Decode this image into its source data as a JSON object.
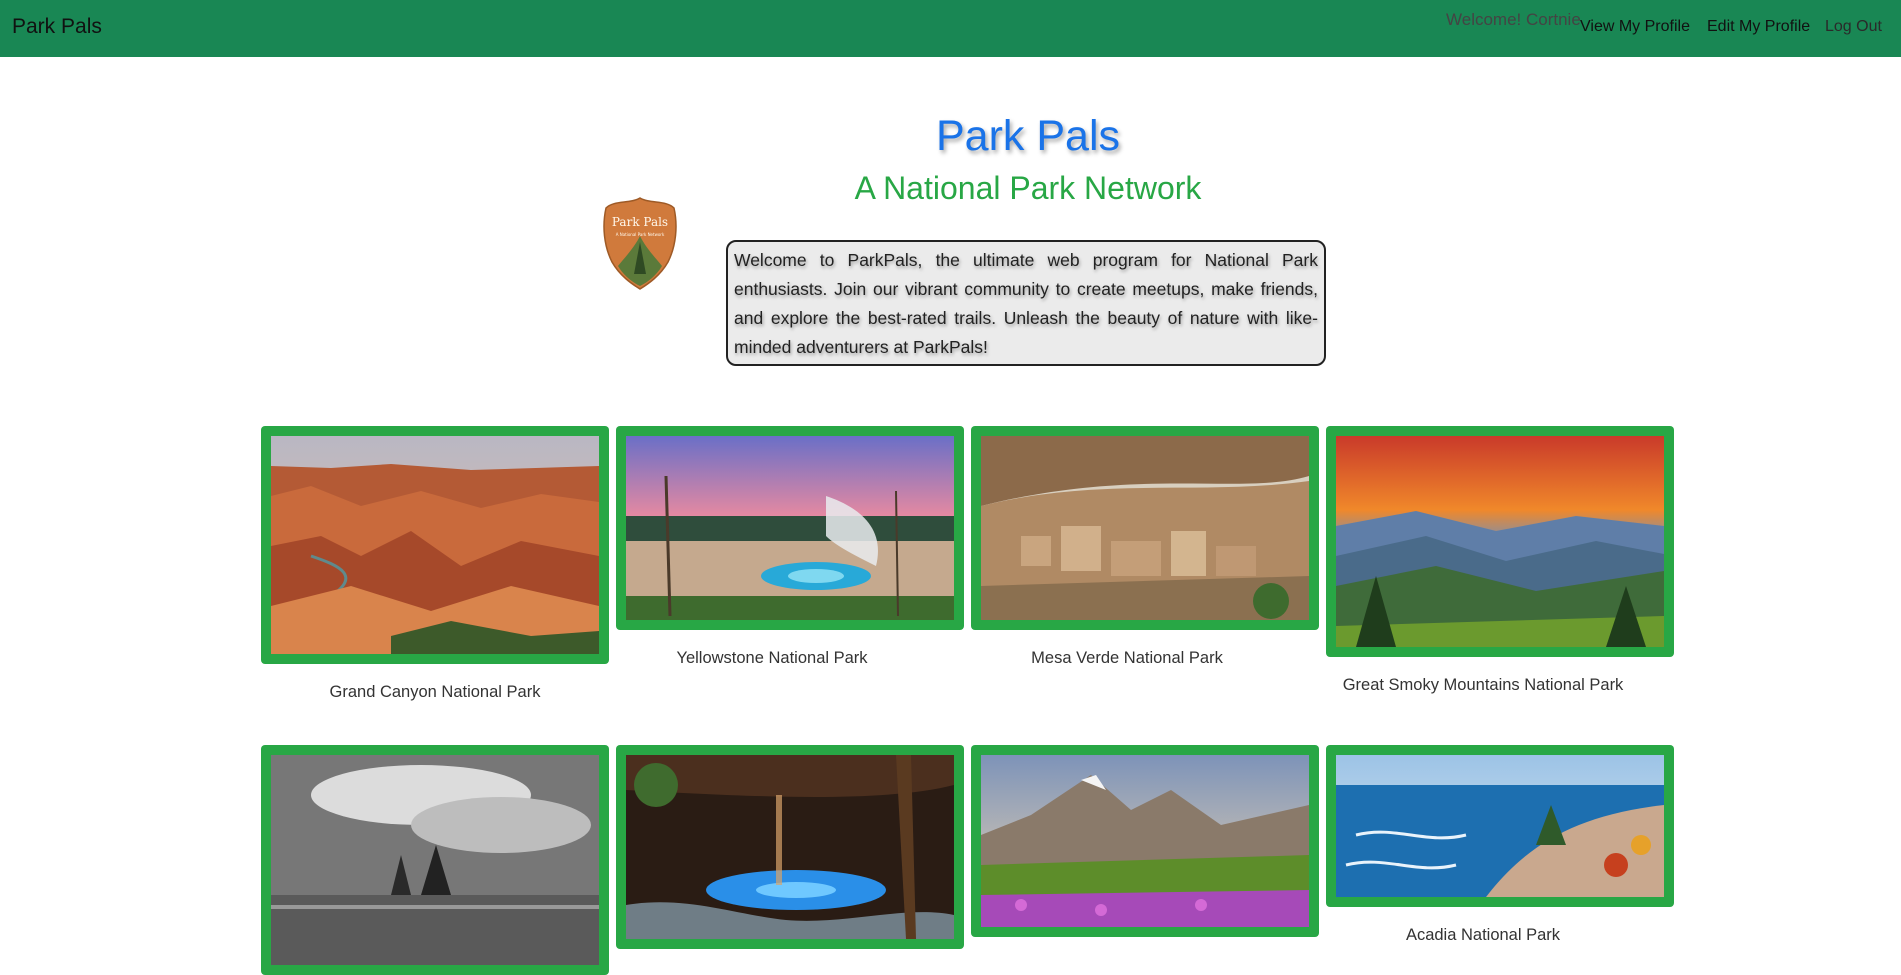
{
  "navbar": {
    "brand": "Park Pals",
    "welcome": "Welcome! Cortnie",
    "links": [
      "View My Profile",
      "Edit My Profile",
      "Log Out"
    ],
    "bg_color": "#198754"
  },
  "header": {
    "title": "Park Pals",
    "subtitle": "A National Park Network",
    "title_color": "#1a73e8",
    "subtitle_color": "#28a745"
  },
  "logo": {
    "text_line1": "Park Pals",
    "text_line2": "A National Park Network",
    "icon": "arrowhead-badge-icon"
  },
  "intro": "Welcome to ParkPals, the ultimate web program for National Park enthusiasts. Join our vibrant community to create meetups, make friends, and explore the best-rated trails. Unleash the beauty of nature with like-minded adventurers at ParkPals!",
  "parks": [
    {
      "name": "Grand Canyon National Park",
      "image": "grand-canyon-photo"
    },
    {
      "name": "Yellowstone National Park",
      "image": "yellowstone-geyser-photo"
    },
    {
      "name": "Mesa Verde National Park",
      "image": "mesa-verde-cliff-dwellings-photo"
    },
    {
      "name": "Great Smoky Mountains National Park",
      "image": "smoky-mountains-sunset-photo"
    },
    {
      "name": "",
      "image": "everglades-black-and-white-photo"
    },
    {
      "name": "",
      "image": "cave-pool-photo"
    },
    {
      "name": "",
      "image": "glacier-wildflowers-photo"
    },
    {
      "name": "Acadia National Park",
      "image": "acadia-coast-photo"
    }
  ],
  "colors": {
    "card_border": "#28a745",
    "accent_blue": "#1a73e8"
  }
}
